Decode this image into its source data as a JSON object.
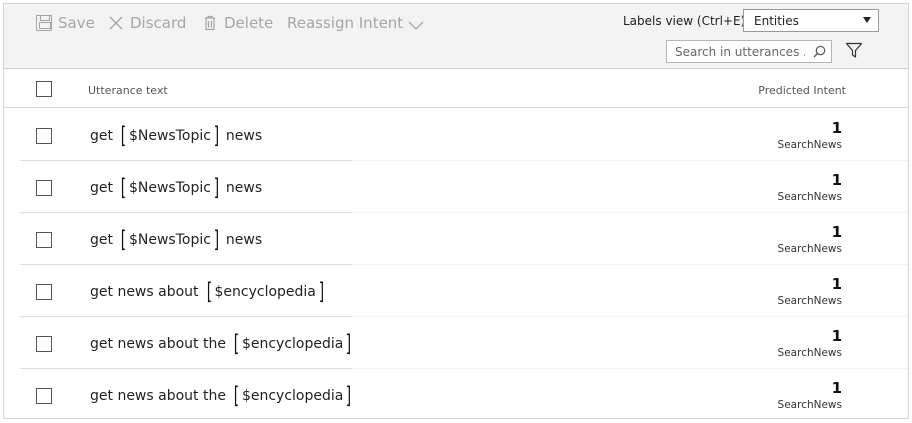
{
  "toolbar": {
    "save_label": "Save",
    "discard_label": "Discard",
    "delete_label": "Delete",
    "reassign_label": "Reassign Intent",
    "labels_view_label": "Labels view (Ctrl+E):",
    "labels_view_selected": "Entities",
    "search_placeholder": "Search in utterances ...",
    "icons": [
      "save-icon",
      "discard-icon",
      "delete-icon",
      "chevron-down-icon",
      "search-icon",
      "filter-icon"
    ]
  },
  "table": {
    "columns": {
      "utterance": "Utterance text",
      "intent": "Predicted Intent"
    },
    "rows": [
      {
        "prefix": "get",
        "entity": "$NewsTopic",
        "suffix": "news",
        "score": "1",
        "intent": "SearchNews"
      },
      {
        "prefix": "get",
        "entity": "$NewsTopic",
        "suffix": "news",
        "score": "1",
        "intent": "SearchNews"
      },
      {
        "prefix": "get",
        "entity": "$NewsTopic",
        "suffix": "news",
        "score": "1",
        "intent": "SearchNews"
      },
      {
        "prefix": "get news about",
        "entity": "$encyclopedia",
        "suffix": "",
        "score": "1",
        "intent": "SearchNews"
      },
      {
        "prefix": "get news about the",
        "entity": "$encyclopedia",
        "suffix": "",
        "score": "1",
        "intent": "SearchNews"
      },
      {
        "prefix": "get news about the",
        "entity": "$encyclopedia",
        "suffix": "",
        "score": "1",
        "intent": "SearchNews"
      }
    ]
  },
  "colors": {
    "toolbar_bg": "#f3f3f3",
    "disabled_text": "#a6a6a6",
    "border": "#d4d4d4"
  }
}
